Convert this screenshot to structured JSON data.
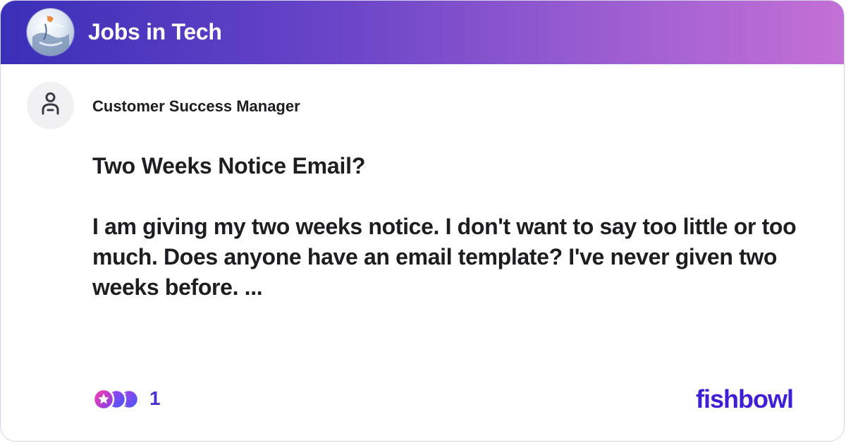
{
  "header": {
    "title": "Jobs in Tech",
    "avatar_icon": "fishbowl-bowl-icon"
  },
  "post": {
    "author": "Customer Success Manager",
    "author_avatar_icon": "user-icon",
    "title": "Two Weeks Notice Email?",
    "body": "I am giving my two weeks notice. I don't want to say too little or too much. Does anyone have an email template? I've never given two weeks before. ..."
  },
  "footer": {
    "reaction_icons": [
      "star-reaction-icon",
      "moon-reaction-icon",
      "moon-reaction-icon"
    ],
    "reaction_count": "1",
    "brand": "fishbowl"
  },
  "colors": {
    "header_gradient_start": "#3a2fb8",
    "header_gradient_end": "#c470d6",
    "accent": "#3d1fd6",
    "text": "#1d1d22"
  }
}
